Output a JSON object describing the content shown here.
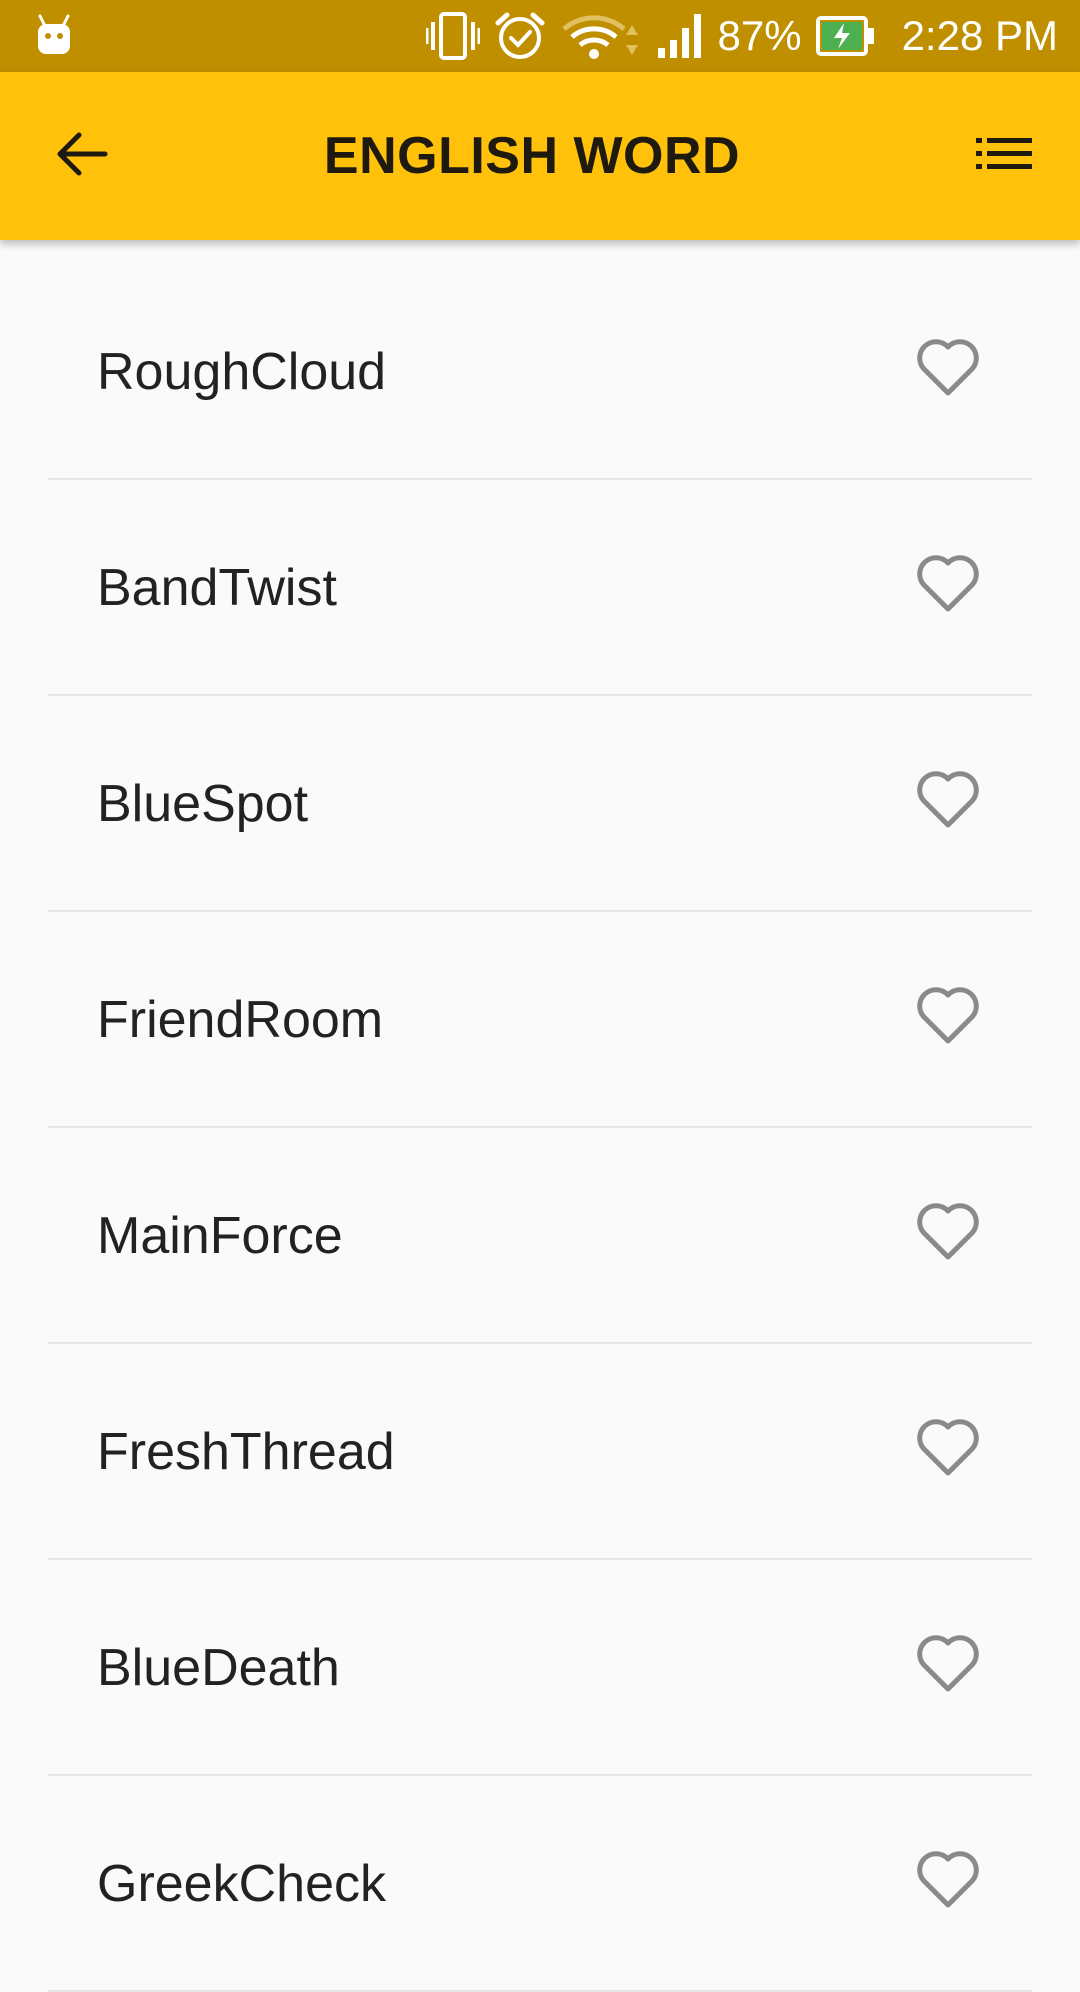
{
  "status_bar": {
    "battery_percent": "87%",
    "time": "2:28 PM"
  },
  "app_bar": {
    "title": "ENGLISH WORD"
  },
  "words": [
    {
      "label": "RoughCloud",
      "favorite": false
    },
    {
      "label": "BandTwist",
      "favorite": false
    },
    {
      "label": "BlueSpot",
      "favorite": false
    },
    {
      "label": "FriendRoom",
      "favorite": false
    },
    {
      "label": "MainForce",
      "favorite": false
    },
    {
      "label": "FreshThread",
      "favorite": false
    },
    {
      "label": "BlueDeath",
      "favorite": false
    },
    {
      "label": "GreekCheck",
      "favorite": false
    }
  ],
  "colors": {
    "status_bar": "#bf8f00",
    "app_bar": "#ffc10a",
    "background": "#fafafa",
    "heart": "#8a8a8a"
  }
}
